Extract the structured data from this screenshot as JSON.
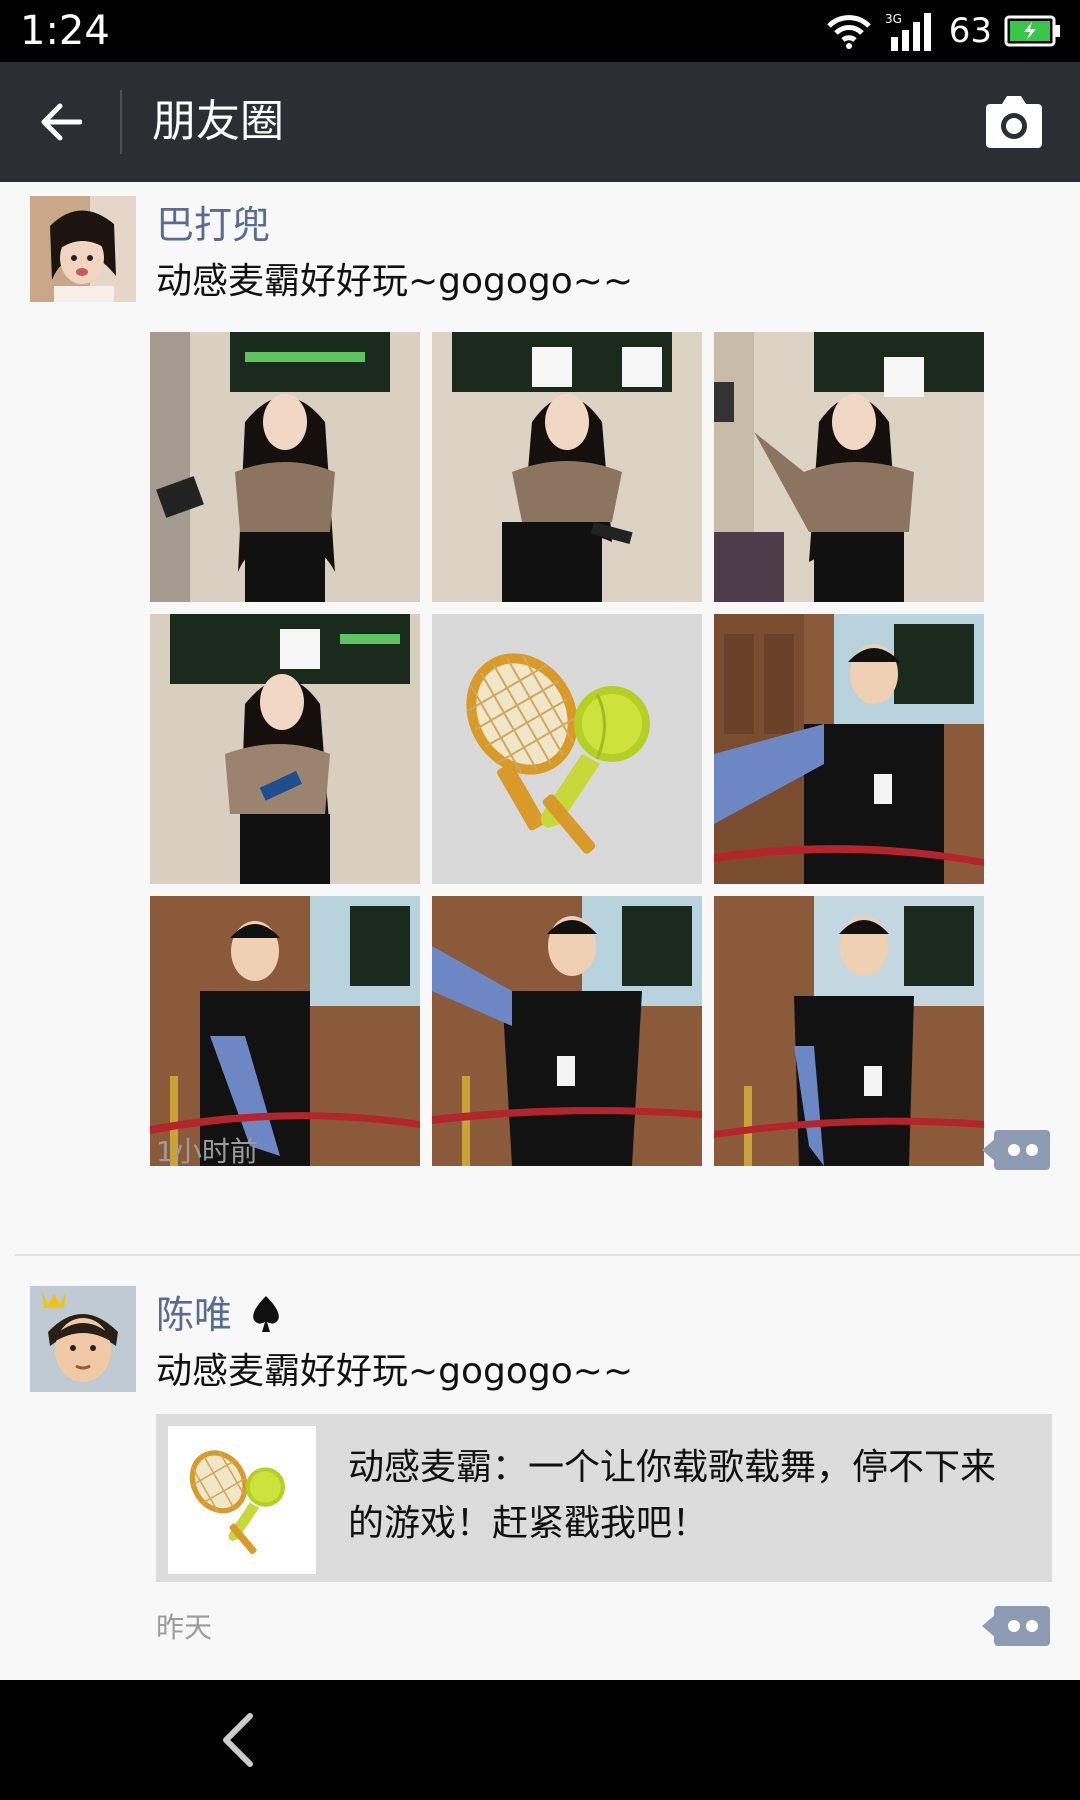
{
  "status": {
    "time": "1:24",
    "battery": "63",
    "network": "3G"
  },
  "header": {
    "title": "朋友圈"
  },
  "posts": [
    {
      "name": "巴打兜",
      "text": "动感麦霸好好玩~gogogo~~",
      "time": "1小时前"
    },
    {
      "name": "陈唯",
      "text": "动感麦霸好好玩~gogogo~~",
      "time": "昨天",
      "share": {
        "text": "动感麦霸：一个让你载歌载舞，停不下来的游戏！赶紧戳我吧！"
      }
    }
  ],
  "icons": [
    "back-arrow-icon",
    "camera-icon",
    "wifi-icon",
    "signal-icon",
    "battery-icon",
    "comment-icon",
    "spade-icon",
    "racket-microphone-icon",
    "nav-back-icon"
  ],
  "colors": {
    "name": "#576b95",
    "navbar": "#2b2f33",
    "comment": "#8d9cb3"
  }
}
